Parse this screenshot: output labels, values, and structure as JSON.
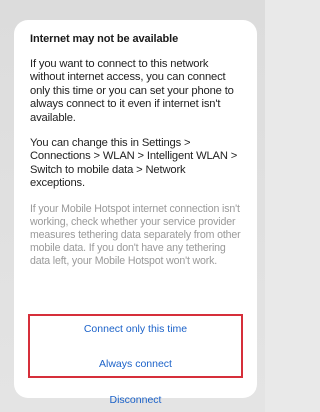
{
  "dialog": {
    "title": "Internet may not be available",
    "paragraph_1": "If you want to connect to this network without internet access, you can connect only this time or you can set your phone to always connect to it even if internet isn't available.",
    "paragraph_2": "You can change this in Settings > Connections > WLAN > Intelligent WLAN > Switch to mobile data > Network exceptions.",
    "paragraph_3": "If your Mobile Hotspot internet connection isn't working, check whether your service provider measures tethering data separately from other mobile data. If you don't have any tethering data left, your Mobile Hotspot won't work."
  },
  "actions": {
    "connect_once_label": "Connect only this time",
    "always_connect_label": "Always connect",
    "disconnect_label": "Disconnect"
  },
  "colors": {
    "accent": "#1b62c9",
    "highlight_border": "#d62f3a",
    "muted_text": "#9a9a9a"
  }
}
